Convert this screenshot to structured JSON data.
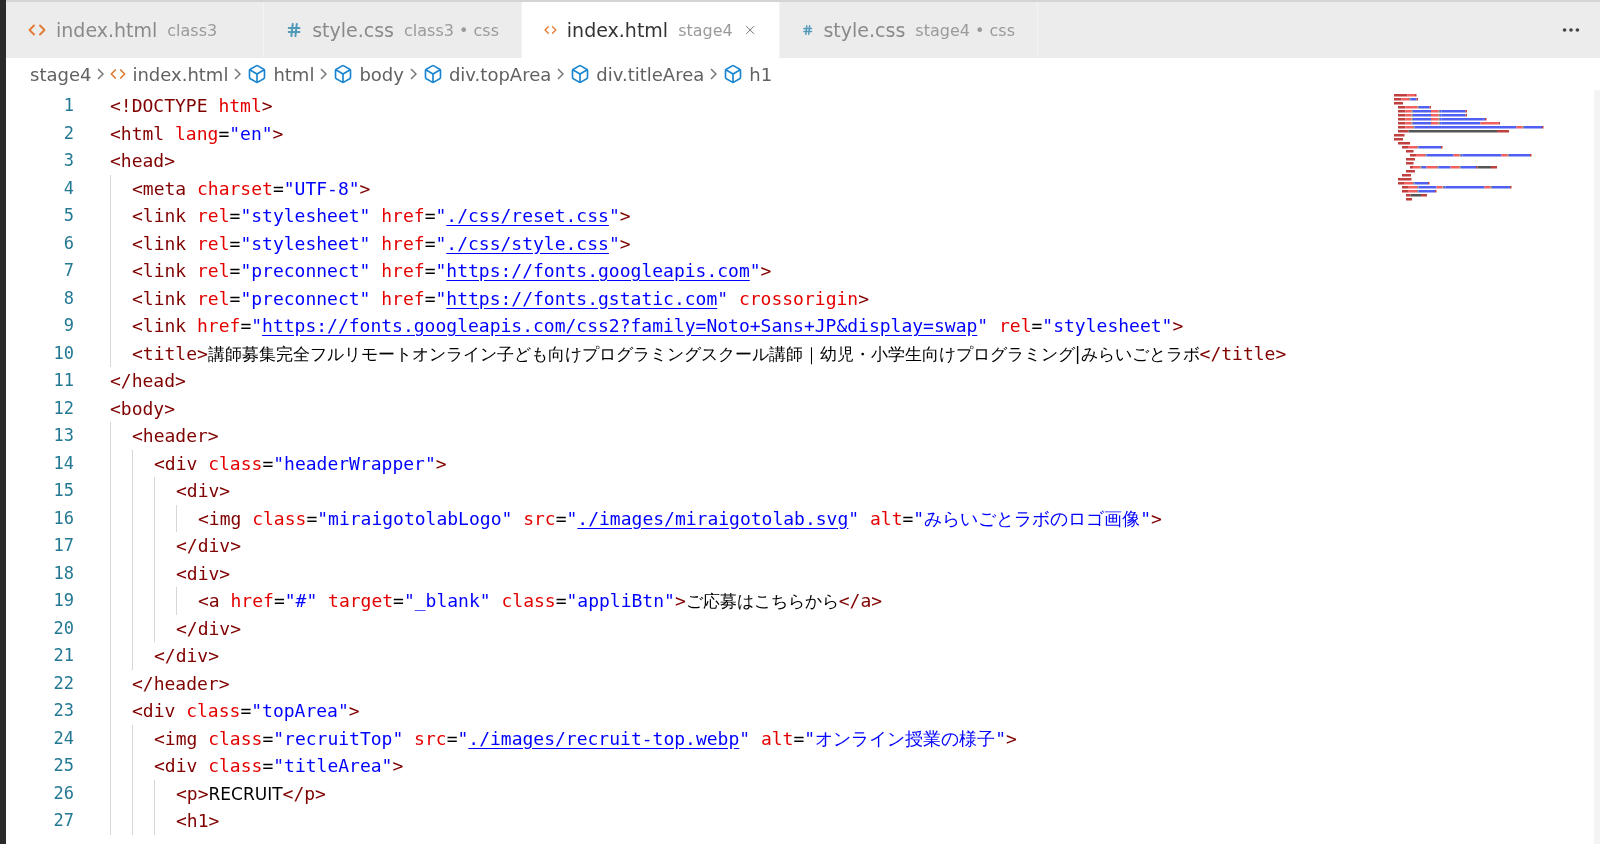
{
  "tabs": [
    {
      "kind": "html",
      "name": "index.html",
      "description": "class3",
      "selected": false
    },
    {
      "kind": "css",
      "name": "style.css",
      "description": "class3 • css",
      "selected": false
    },
    {
      "kind": "html",
      "name": "index.html",
      "description": "stage4",
      "selected": true
    },
    {
      "kind": "css",
      "name": "style.css",
      "description": "stage4 • css",
      "selected": false
    }
  ],
  "breadcrumbs": [
    {
      "kind": "folder",
      "label": "stage4"
    },
    {
      "kind": "html",
      "label": "index.html"
    },
    {
      "kind": "element",
      "label": "html"
    },
    {
      "kind": "element",
      "label": "body"
    },
    {
      "kind": "element",
      "label": "div.topArea"
    },
    {
      "kind": "element",
      "label": "div.titleArea"
    },
    {
      "kind": "element",
      "label": "h1"
    }
  ],
  "lines": [
    {
      "number": "1",
      "tokens": [
        {
          "kind": "tag",
          "text": "<!DOCTYPE"
        },
        {
          "kind": "attr",
          "text": " html"
        },
        {
          "kind": "tag",
          "text": ">"
        }
      ]
    },
    {
      "number": "2",
      "tokens": [
        {
          "kind": "tag",
          "text": "<html"
        },
        {
          "kind": "attr",
          "text": " lang"
        },
        {
          "kind": "punct",
          "text": "="
        },
        {
          "kind": "string",
          "text": "\"en\""
        },
        {
          "kind": "tag",
          "text": ">"
        }
      ]
    },
    {
      "number": "3",
      "tokens": [
        {
          "kind": "tag",
          "text": "<head>"
        }
      ],
      "children": [
        {
          "number": "4",
          "tokens": [
            {
              "kind": "tag",
              "text": "<meta"
            },
            {
              "kind": "attr",
              "text": " charset"
            },
            {
              "kind": "punct",
              "text": "="
            },
            {
              "kind": "string",
              "text": "\"UTF-8\""
            },
            {
              "kind": "tag",
              "text": ">"
            }
          ]
        },
        {
          "number": "5",
          "tokens": [
            {
              "kind": "tag",
              "text": "<link"
            },
            {
              "kind": "attr",
              "text": " rel"
            },
            {
              "kind": "punct",
              "text": "="
            },
            {
              "kind": "string",
              "text": "\"stylesheet\""
            },
            {
              "kind": "attr",
              "text": " href"
            },
            {
              "kind": "punct",
              "text": "="
            },
            {
              "kind": "string",
              "text": "\""
            },
            {
              "kind": "link",
              "text": "./css/reset.css"
            },
            {
              "kind": "string",
              "text": "\""
            },
            {
              "kind": "tag",
              "text": ">"
            }
          ]
        },
        {
          "number": "6",
          "tokens": [
            {
              "kind": "tag",
              "text": "<link"
            },
            {
              "kind": "attr",
              "text": " rel"
            },
            {
              "kind": "punct",
              "text": "="
            },
            {
              "kind": "string",
              "text": "\"stylesheet\""
            },
            {
              "kind": "attr",
              "text": " href"
            },
            {
              "kind": "punct",
              "text": "="
            },
            {
              "kind": "string",
              "text": "\""
            },
            {
              "kind": "link",
              "text": "./css/style.css"
            },
            {
              "kind": "string",
              "text": "\""
            },
            {
              "kind": "tag",
              "text": ">"
            }
          ]
        },
        {
          "number": "7",
          "tokens": [
            {
              "kind": "tag",
              "text": "<link"
            },
            {
              "kind": "attr",
              "text": " rel"
            },
            {
              "kind": "punct",
              "text": "="
            },
            {
              "kind": "string",
              "text": "\"preconnect\""
            },
            {
              "kind": "attr",
              "text": " href"
            },
            {
              "kind": "punct",
              "text": "="
            },
            {
              "kind": "string",
              "text": "\""
            },
            {
              "kind": "link",
              "text": "https://fonts.googleapis.com"
            },
            {
              "kind": "string",
              "text": "\""
            },
            {
              "kind": "tag",
              "text": ">"
            }
          ]
        },
        {
          "number": "8",
          "tokens": [
            {
              "kind": "tag",
              "text": "<link"
            },
            {
              "kind": "attr",
              "text": " rel"
            },
            {
              "kind": "punct",
              "text": "="
            },
            {
              "kind": "string",
              "text": "\"preconnect\""
            },
            {
              "kind": "attr",
              "text": " href"
            },
            {
              "kind": "punct",
              "text": "="
            },
            {
              "kind": "string",
              "text": "\""
            },
            {
              "kind": "link",
              "text": "https://fonts.gstatic.com"
            },
            {
              "kind": "string",
              "text": "\""
            },
            {
              "kind": "attr",
              "text": " crossorigin"
            },
            {
              "kind": "tag",
              "text": ">"
            }
          ]
        },
        {
          "number": "9",
          "tokens": [
            {
              "kind": "tag",
              "text": "<link"
            },
            {
              "kind": "attr",
              "text": " href"
            },
            {
              "kind": "punct",
              "text": "="
            },
            {
              "kind": "string",
              "text": "\""
            },
            {
              "kind": "link",
              "text": "https://fonts.googleapis.com/css2?family=Noto+Sans+JP&display=swap"
            },
            {
              "kind": "string",
              "text": "\""
            },
            {
              "kind": "attr",
              "text": " rel"
            },
            {
              "kind": "punct",
              "text": "="
            },
            {
              "kind": "string",
              "text": "\"stylesheet\""
            },
            {
              "kind": "tag",
              "text": ">"
            }
          ]
        },
        {
          "number": "10",
          "tokens": [
            {
              "kind": "tag",
              "text": "<title>"
            },
            {
              "kind": "text",
              "text": "講師募集完全フルリモートオンライン子ども向けプログラミングスクール講師｜幼児・小学生向けプログラミング|みらいごとラボ"
            },
            {
              "kind": "tag",
              "text": "</title>"
            }
          ]
        }
      ]
    },
    {
      "number": "11",
      "tokens": [
        {
          "kind": "tag",
          "text": "</head>"
        }
      ]
    },
    {
      "number": "12",
      "tokens": [
        {
          "kind": "tag",
          "text": "<body>"
        }
      ],
      "children": [
        {
          "number": "13",
          "tokens": [
            {
              "kind": "tag",
              "text": "<header>"
            }
          ],
          "children": [
            {
              "number": "14",
              "tokens": [
                {
                  "kind": "tag",
                  "text": "<div"
                },
                {
                  "kind": "attr",
                  "text": " class"
                },
                {
                  "kind": "punct",
                  "text": "="
                },
                {
                  "kind": "string",
                  "text": "\"headerWrapper\""
                },
                {
                  "kind": "tag",
                  "text": ">"
                }
              ],
              "children": [
                {
                  "number": "15",
                  "tokens": [
                    {
                      "kind": "tag",
                      "text": "<div>"
                    }
                  ],
                  "children": [
                    {
                      "number": "16",
                      "tokens": [
                        {
                          "kind": "tag",
                          "text": "<img"
                        },
                        {
                          "kind": "attr",
                          "text": " class"
                        },
                        {
                          "kind": "punct",
                          "text": "="
                        },
                        {
                          "kind": "string",
                          "text": "\"miraigotolabLogo\""
                        },
                        {
                          "kind": "attr",
                          "text": " src"
                        },
                        {
                          "kind": "punct",
                          "text": "="
                        },
                        {
                          "kind": "string",
                          "text": "\""
                        },
                        {
                          "kind": "link",
                          "text": "./images/miraigotolab.svg"
                        },
                        {
                          "kind": "string",
                          "text": "\""
                        },
                        {
                          "kind": "attr",
                          "text": " alt"
                        },
                        {
                          "kind": "punct",
                          "text": "="
                        },
                        {
                          "kind": "string",
                          "text": "\"みらいごとラボのロゴ画像\""
                        },
                        {
                          "kind": "tag",
                          "text": ">"
                        }
                      ]
                    }
                  ]
                },
                {
                  "number": "17",
                  "tokens": [
                    {
                      "kind": "tag",
                      "text": "</div>"
                    }
                  ]
                },
                {
                  "number": "18",
                  "tokens": [
                    {
                      "kind": "tag",
                      "text": "<div>"
                    }
                  ],
                  "children": [
                    {
                      "number": "19",
                      "tokens": [
                        {
                          "kind": "tag",
                          "text": "<a"
                        },
                        {
                          "kind": "attr",
                          "text": " href"
                        },
                        {
                          "kind": "punct",
                          "text": "="
                        },
                        {
                          "kind": "string",
                          "text": "\"#\""
                        },
                        {
                          "kind": "attr",
                          "text": " target"
                        },
                        {
                          "kind": "punct",
                          "text": "="
                        },
                        {
                          "kind": "string",
                          "text": "\"_blank\""
                        },
                        {
                          "kind": "attr",
                          "text": " class"
                        },
                        {
                          "kind": "punct",
                          "text": "="
                        },
                        {
                          "kind": "string",
                          "text": "\"appliBtn\""
                        },
                        {
                          "kind": "tag",
                          "text": ">"
                        },
                        {
                          "kind": "text",
                          "text": "ご応募はこちらから"
                        },
                        {
                          "kind": "tag",
                          "text": "</a>"
                        }
                      ]
                    }
                  ]
                },
                {
                  "number": "20",
                  "tokens": [
                    {
                      "kind": "tag",
                      "text": "</div>"
                    }
                  ]
                }
              ]
            },
            {
              "number": "21",
              "tokens": [
                {
                  "kind": "tag",
                  "text": "</div>"
                }
              ]
            }
          ]
        },
        {
          "number": "22",
          "tokens": [
            {
              "kind": "tag",
              "text": "</header>"
            }
          ]
        },
        {
          "number": "23",
          "tokens": [
            {
              "kind": "tag",
              "text": "<div"
            },
            {
              "kind": "attr",
              "text": " class"
            },
            {
              "kind": "punct",
              "text": "="
            },
            {
              "kind": "string",
              "text": "\"topArea\""
            },
            {
              "kind": "tag",
              "text": ">"
            }
          ],
          "children": [
            {
              "number": "24",
              "tokens": [
                {
                  "kind": "tag",
                  "text": "<img"
                },
                {
                  "kind": "attr",
                  "text": " class"
                },
                {
                  "kind": "punct",
                  "text": "="
                },
                {
                  "kind": "string",
                  "text": "\"recruitTop\""
                },
                {
                  "kind": "attr",
                  "text": " src"
                },
                {
                  "kind": "punct",
                  "text": "="
                },
                {
                  "kind": "string",
                  "text": "\""
                },
                {
                  "kind": "link",
                  "text": "./images/recruit-top.webp"
                },
                {
                  "kind": "string",
                  "text": "\""
                },
                {
                  "kind": "attr",
                  "text": " alt"
                },
                {
                  "kind": "punct",
                  "text": "="
                },
                {
                  "kind": "string",
                  "text": "\"オンライン授業の様子\""
                },
                {
                  "kind": "tag",
                  "text": ">"
                }
              ]
            },
            {
              "number": "25",
              "tokens": [
                {
                  "kind": "tag",
                  "text": "<div"
                },
                {
                  "kind": "attr",
                  "text": " class"
                },
                {
                  "kind": "punct",
                  "text": "="
                },
                {
                  "kind": "string",
                  "text": "\"titleArea\""
                },
                {
                  "kind": "tag",
                  "text": ">"
                }
              ],
              "children": [
                {
                  "number": "26",
                  "tokens": [
                    {
                      "kind": "tag",
                      "text": "<p>"
                    },
                    {
                      "kind": "text",
                      "text": "RECRUIT"
                    },
                    {
                      "kind": "tag",
                      "text": "</p>"
                    }
                  ]
                },
                {
                  "number": "27",
                  "tokens": [
                    {
                      "kind": "tag",
                      "text": "<h1>"
                    }
                  ]
                }
              ]
            }
          ]
        }
      ]
    }
  ]
}
